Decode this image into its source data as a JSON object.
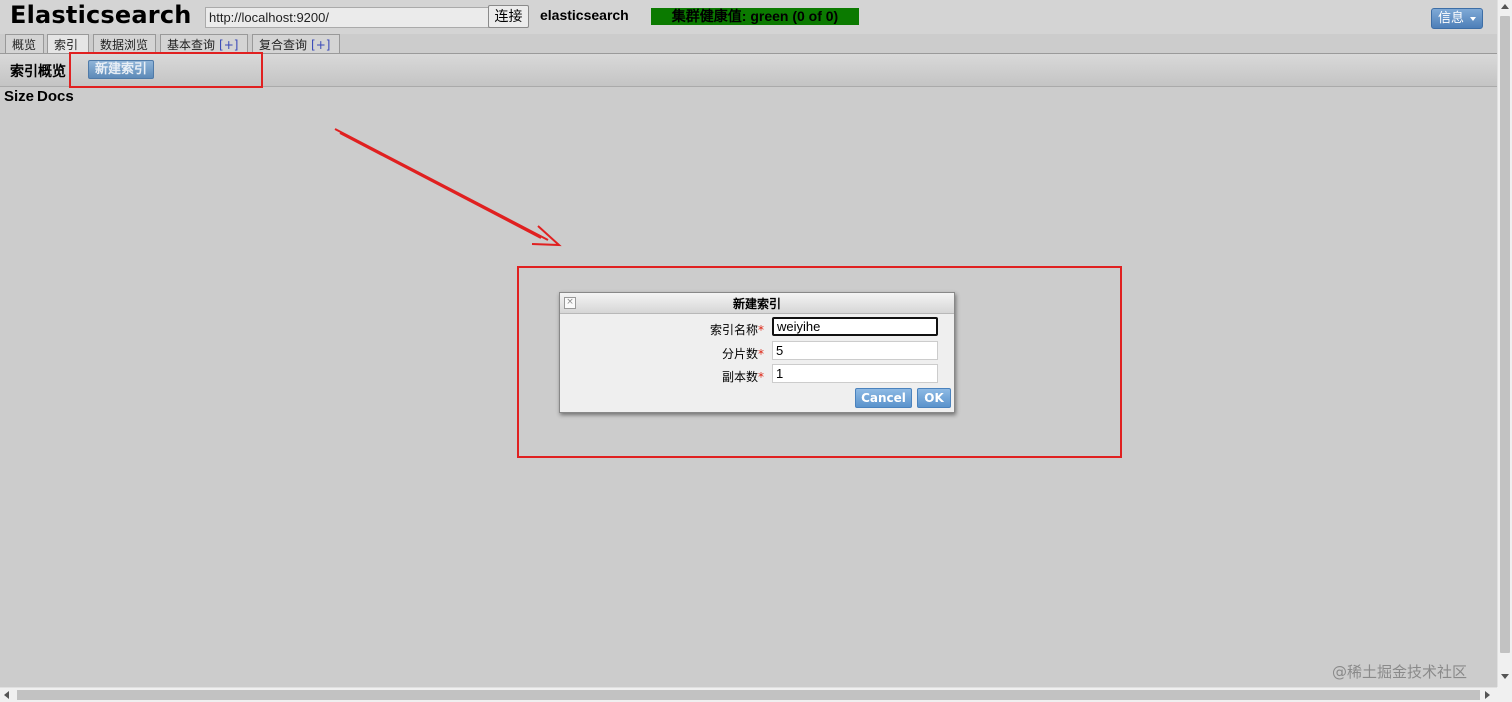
{
  "header": {
    "brand": "Elasticsearch",
    "url": "http://localhost:9200/",
    "connect_label": "连接",
    "cluster_name": "elasticsearch",
    "health_text": "集群健康值: green (0 of 0)",
    "health_color": "#0b7a00",
    "info_label": "信息"
  },
  "tabs": [
    {
      "label": "概览"
    },
    {
      "label": "索引",
      "active": true
    },
    {
      "label": "数据浏览"
    },
    {
      "label": "基本查询",
      "plus": "[+]"
    },
    {
      "label": "复合查询",
      "plus": "[+]"
    }
  ],
  "subheader": {
    "title": "索引概览",
    "new_index_label": "新建索引"
  },
  "table": {
    "columns": [
      "Size",
      "Docs"
    ]
  },
  "dialog": {
    "title": "新建索引",
    "fields": [
      {
        "label": "索引名称",
        "required_mark": "*",
        "value": "weiyihe"
      },
      {
        "label": "分片数",
        "required_mark": "*",
        "value": "5"
      },
      {
        "label": "副本数",
        "required_mark": "*",
        "value": "1"
      }
    ],
    "cancel_label": "Cancel",
    "ok_label": "OK"
  },
  "annotations": {
    "highlight_color": "#e02020"
  },
  "watermark": "@稀土掘金技术社区"
}
